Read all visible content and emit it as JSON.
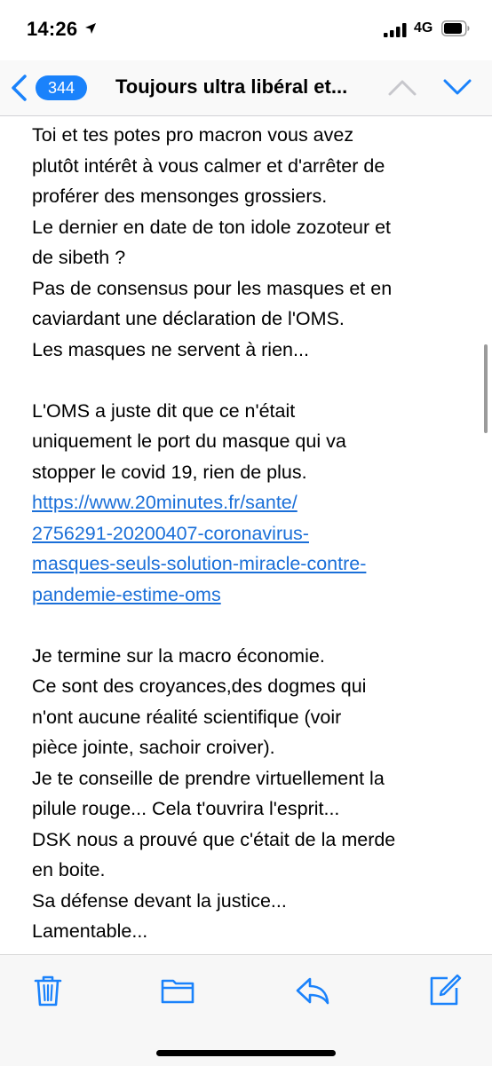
{
  "status_bar": {
    "time": "14:26",
    "network": "4G",
    "icons": [
      "location-arrow-icon",
      "signal-bars-icon",
      "battery-icon"
    ]
  },
  "nav": {
    "back_count": "344",
    "title": "Toujours ultra libéral et...",
    "icons": [
      "chevron-left-icon",
      "chevron-up-icon",
      "chevron-down-icon"
    ],
    "accent_color": "#1a82fb"
  },
  "message": {
    "lines": [
      "Toi et tes potes pro macron vous avez",
      "plutôt intérêt à vous calmer et d'arrêter de",
      "proférer des mensonges grossiers.",
      "Le dernier en date de ton idole zozoteur et",
      "de sibeth ?",
      "Pas de consensus pour les masques et en",
      "caviardant une déclaration de l'OMS.",
      "Les masques ne servent à rien...",
      "",
      "L'OMS a juste dit que ce n'était",
      "uniquement le port du masque qui va",
      "stopper le covid 19, rien de plus.",
      "https://www.20minutes.fr/sante/",
      "2756291-20200407-coronavirus-",
      "masques-seuls-solution-miracle-contre-",
      "pandemie-estime-oms",
      "",
      "Je termine sur la macro économie.",
      "Ce sont des croyances,des dogmes qui",
      "n'ont aucune réalité scientifique (voir",
      "pièce jointe, sachoir croiver).",
      "Je te conseille de prendre virtuellement la",
      "pilule rouge... Cela t'ouvrira l'esprit...",
      "DSK nous a prouvé que c'était de la merde",
      "en boite.",
      "Sa défense devant la justice...",
      "Lamentable..."
    ],
    "link_line_indices": [
      12,
      13,
      14,
      15
    ]
  },
  "toolbar": {
    "icons": [
      "trash-icon",
      "folder-icon",
      "reply-icon",
      "compose-icon"
    ]
  }
}
